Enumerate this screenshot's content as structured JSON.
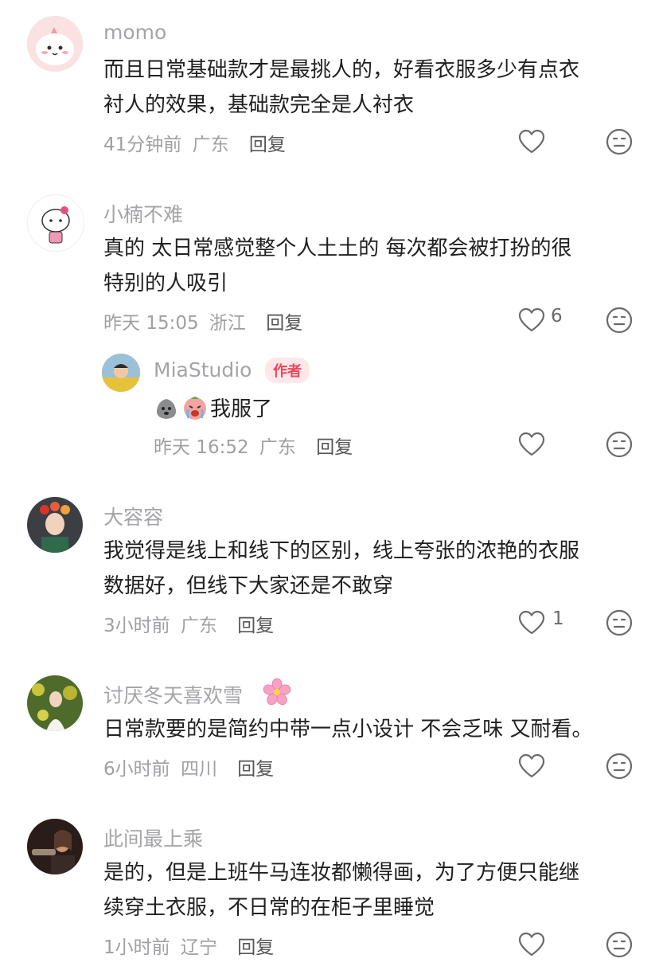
{
  "comments": [
    {
      "username": "momo",
      "lines": [
        "而且日常基础款才是最挑人的，好看衣服多少有点衣",
        "衬人的效果，基础款完全是人衬衣"
      ],
      "time": "41分钟前",
      "location": "广东",
      "reply_label": "回复",
      "likes": ""
    },
    {
      "username": "小楠不难",
      "lines": [
        "真的 太日常感觉整个人土土的 每次都会被打扮的很",
        "特别的人吸引"
      ],
      "time": "昨天 15:05",
      "location": "浙江",
      "reply_label": "回复",
      "likes": "6"
    },
    {
      "username": "大容容",
      "lines": [
        "我觉得是线上和线下的区别，线上夸张的浓艳的衣服",
        "数据好，但线下大家还是不敢穿"
      ],
      "time": "3小时前",
      "location": "广东",
      "reply_label": "回复",
      "likes": "1"
    },
    {
      "username": "讨厌冬天喜欢雪",
      "lines": [
        "日常款要的是简约中带一点小设计 不会乏味 又耐看。"
      ],
      "time": "6小时前",
      "location": "四川",
      "reply_label": "回复",
      "likes": ""
    },
    {
      "username": "此间最上乘",
      "lines": [
        "是的，但是上班牛马连妆都懒得画，为了方便只能继",
        "续穿土衣服，不日常的在柜子里睡觉"
      ],
      "time": "1小时前",
      "location": "辽宁",
      "reply_label": "回复",
      "likes": ""
    }
  ],
  "reply": {
    "username": "MiaStudio",
    "author_tag": "作者",
    "text": "我服了",
    "time": "昨天 16:52",
    "location": "广东",
    "reply_label": "回复",
    "likes": ""
  },
  "icons": [
    "heart-icon",
    "dislike-face-icon",
    "cherry-blossom-icon",
    "crying-face-icon",
    "gray-blob-emoji-icon"
  ],
  "colors": {
    "author_tag_bg": "#fde7ea",
    "author_tag_text": "#f0455a",
    "username": "#a4a4a8",
    "body": "#202020"
  }
}
